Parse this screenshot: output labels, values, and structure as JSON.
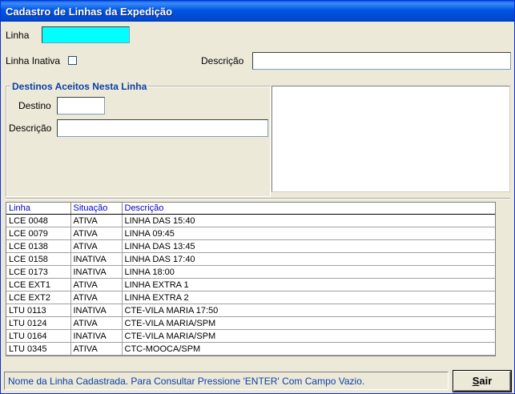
{
  "window": {
    "title": "Cadastro de Linhas da Expedição"
  },
  "form": {
    "linha_label": "Linha",
    "linha_value": "",
    "inativa_label": "Linha Inativa",
    "inativa_checked": false,
    "descricao_label": "Descrição",
    "descricao_value": ""
  },
  "destinos": {
    "title": "Destinos Aceitos Nesta Linha",
    "destino_label": "Destino",
    "destino_value": "",
    "descricao_label": "Descrição",
    "descricao_value": ""
  },
  "grid": {
    "columns": [
      "Linha",
      "Situação",
      "Descrição"
    ],
    "rows": [
      [
        "LCE 0048",
        "ATIVA",
        "LINHA DAS 15:40"
      ],
      [
        "LCE 0079",
        "ATIVA",
        "LINHA 09:45"
      ],
      [
        "LCE 0138",
        "ATIVA",
        "LINHA DAS 13:45"
      ],
      [
        "LCE 0158",
        "INATIVA",
        "LINHA DAS 17:40"
      ],
      [
        "LCE 0173",
        "INATIVA",
        "LINHA 18:00"
      ],
      [
        "LCE EXT1",
        "ATIVA",
        "LINHA EXTRA 1"
      ],
      [
        "LCE EXT2",
        "ATIVA",
        "LINHA EXTRA 2"
      ],
      [
        "LTU 0113",
        "INATIVA",
        "CTE-VILA MARIA 17:50"
      ],
      [
        "LTU 0124",
        "ATIVA",
        "CTE-VILA MARIA/SPM"
      ],
      [
        "LTU 0164",
        "INATIVA",
        "CTE-VILA MARIA/SPM"
      ],
      [
        "LTU 0345",
        "ATIVA",
        "CTC-MOOCA/SPM"
      ]
    ]
  },
  "status": {
    "message": "Nome da Linha Cadastrada. Para Consultar Pressione 'ENTER' Com Campo Vazio."
  },
  "buttons": {
    "sair_accel": "S",
    "sair_rest": "air"
  }
}
